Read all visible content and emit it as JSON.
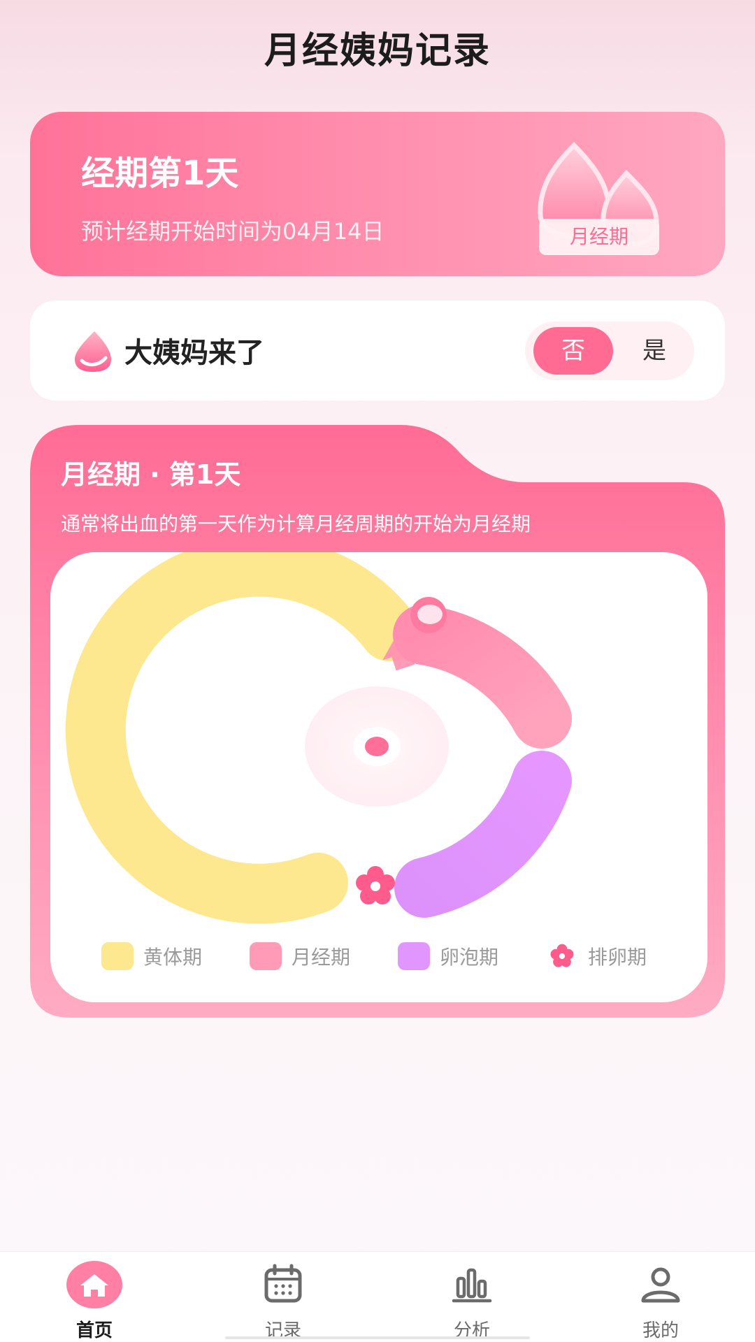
{
  "header": {
    "title": "月经姨妈记录"
  },
  "hero": {
    "title": "经期第1天",
    "subtitle": "预计经期开始时间为04月14日",
    "badge": "月经期"
  },
  "period_toggle": {
    "label": "大姨妈来了",
    "options": [
      "否",
      "是"
    ],
    "selected": "否"
  },
  "cycle": {
    "title": "月经期 · 第1天",
    "description": "通常将出血的第一天作为计算月经周期的开始为月经期",
    "legend": [
      {
        "label": "黄体期",
        "color": "#fde88f"
      },
      {
        "label": "月经期",
        "color": "#ff9bb7"
      },
      {
        "label": "卵泡期",
        "color": "#e196ff"
      },
      {
        "label": "排卵期",
        "color": "#ff5c8d"
      }
    ]
  },
  "bottom_nav": {
    "items": [
      {
        "label": "首页",
        "icon": "home-icon",
        "active": true
      },
      {
        "label": "记录",
        "icon": "calendar-icon",
        "active": false
      },
      {
        "label": "分析",
        "icon": "bar-chart-icon",
        "active": false
      },
      {
        "label": "我的",
        "icon": "user-icon",
        "active": false
      }
    ]
  },
  "colors": {
    "accent": "#ff6b93",
    "card_gradient_start": "#ff7298",
    "card_gradient_end": "#ffa7c1"
  }
}
